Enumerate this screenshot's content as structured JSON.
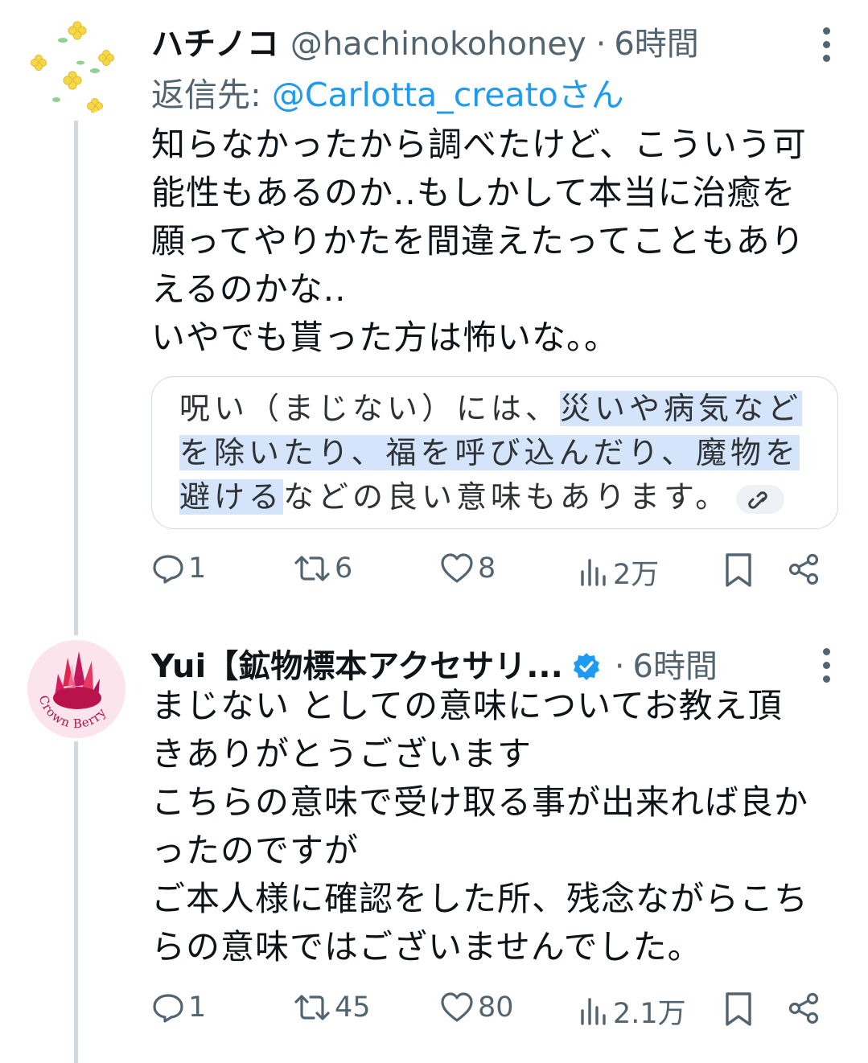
{
  "tweets": [
    {
      "name": "ハチノコ",
      "handle": "@hachinokohoney",
      "separator": "·",
      "time": "6時間",
      "reply_prefix": "返信先: ",
      "reply_handle": "@Carlotta_creato",
      "reply_suffix": "さん",
      "text": "知らなかったから調べたけど、こういう可\n能性もあるのか..もしかして本当に治癒を\n願ってやりかたを間違えたってこともあり\nえるのかな..\nいやでも貰った方は怖いな。。",
      "quote": {
        "part1": "呪い（まじない）には、",
        "hl1": "災いや病気など",
        "hl2": "を除いたり、福を呼び込んだり、魔物を",
        "hl3": "避ける",
        "part2": "などの良い意味もあります。"
      },
      "counts": {
        "replies": "1",
        "retweets": "6",
        "likes": "8",
        "views": "2万"
      }
    },
    {
      "name": "Yui【鉱物標本アクセサリ...",
      "separator": "·",
      "time": "6時間",
      "avatar_text": "Crown Berry",
      "text": "まじない としての意味についてお教え頂\nきありがとうございます\nこちらの意味で受け取る事が出来れば良か\nったのですが\nご本人様に確認をした所、残念ながらこち\nらの意味ではございませんでした。",
      "counts": {
        "replies": "1",
        "retweets": "45",
        "likes": "80",
        "views": "2.1万"
      }
    }
  ],
  "colors": {
    "link": "#1d9bf0",
    "secondary": "#536471",
    "highlight": "#d4e4fb",
    "verified": "#1d9bf0"
  },
  "icons": [
    "reply-icon",
    "retweet-icon",
    "like-icon",
    "views-icon",
    "bookmark-icon",
    "share-icon",
    "more-icon",
    "verified-badge-icon",
    "link-icon"
  ]
}
